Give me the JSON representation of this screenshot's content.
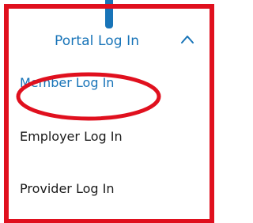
{
  "colors": {
    "annotation": "#e0101e",
    "link": "#1874b8",
    "text": "#1a1a1a",
    "background": "#ffffff"
  },
  "header": {
    "label": "Portal Log In",
    "toggle_icon": "chevron-up-icon"
  },
  "menu": {
    "items": [
      {
        "label": "Member Log In",
        "state": "selected"
      },
      {
        "label": "Employer Log In"
      },
      {
        "label": "Provider Log In"
      }
    ]
  }
}
